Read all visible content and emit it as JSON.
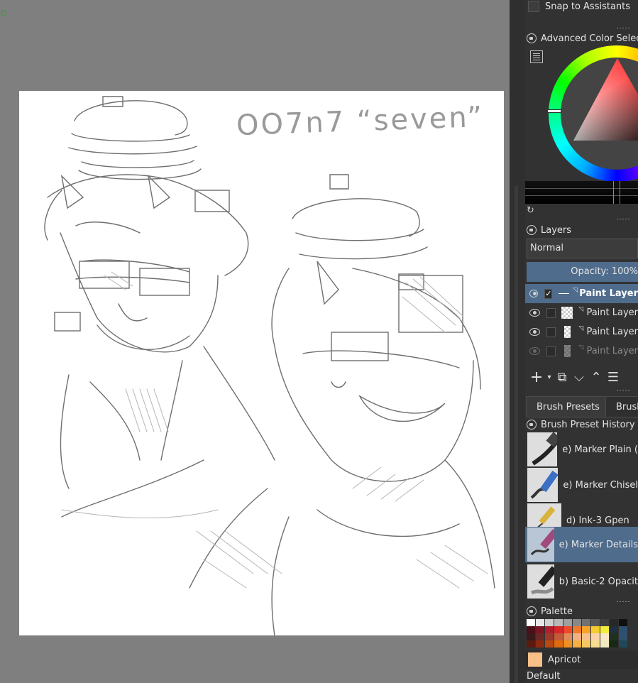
{
  "canvas": {
    "sketch_text": "OO7n7 “seven”"
  },
  "dock": {
    "snap_to_assistants": {
      "label": "Snap to Assistants",
      "checked": false
    },
    "color_selector": {
      "title": "Advanced Color Selector",
      "hue_color": "#ff0000"
    },
    "layers": {
      "title": "Layers",
      "blend_mode": "Normal",
      "opacity_label": "Opacity:  100%",
      "items": [
        {
          "name": "Paint Layer",
          "visible": true,
          "checked": true,
          "active": true
        },
        {
          "name": "Paint Layer",
          "visible": true,
          "checked": false,
          "active": false
        },
        {
          "name": "Paint Layer",
          "visible": true,
          "checked": false,
          "active": false
        },
        {
          "name": "Paint Layer",
          "visible": false,
          "checked": false,
          "active": false
        }
      ],
      "toolbar": [
        "add-layer",
        "duplicate-layer",
        "move-layer-down",
        "move-layer-up",
        "layer-properties"
      ]
    },
    "tabs": [
      {
        "label": "Brush Presets",
        "selected": false
      },
      {
        "label": "Brush",
        "selected": true
      }
    ],
    "brush_history": {
      "title": "Brush Preset History",
      "items": [
        {
          "name": "e) Marker Plain (",
          "active": false
        },
        {
          "name": "e) Marker Chisel",
          "active": false
        },
        {
          "name": "d) Ink-3 Gpen",
          "active": false
        },
        {
          "name": "e) Marker Details",
          "active": true
        },
        {
          "name": "b) Basic-2 Opacit",
          "active": false
        }
      ]
    },
    "palette": {
      "title": "Palette",
      "current_color_name": "Apricot",
      "current_color": "#f8c089",
      "palette_name": "Default",
      "accent": "#4f6c8c"
    }
  }
}
